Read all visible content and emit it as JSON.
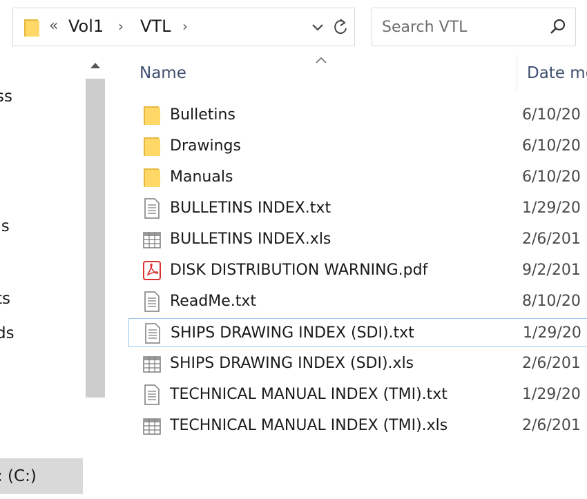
{
  "address_bar": {
    "overflow": "«",
    "breadcrumbs": [
      "Vol1",
      "VTL"
    ],
    "separator": "›",
    "dropdown_icon": "chevron-down-icon",
    "refresh_icon": "refresh-icon"
  },
  "search": {
    "placeholder": "Search VTL",
    "value": "",
    "icon": "search-icon"
  },
  "nav_pane": {
    "items": [
      {
        "label": "ss"
      },
      {
        "label": ":s"
      },
      {
        "label": "ts"
      },
      {
        "label": "ds"
      }
    ],
    "selected_item": {
      "label": ": (C:)"
    }
  },
  "file_list": {
    "columns": [
      {
        "label": "Name",
        "sorted": "ascending"
      },
      {
        "label": "Date mo"
      }
    ],
    "rows": [
      {
        "name": "Bulletins",
        "date": "6/10/20",
        "icon": "folder-icon"
      },
      {
        "name": "Drawings",
        "date": "6/10/20",
        "icon": "folder-icon"
      },
      {
        "name": "Manuals",
        "date": "6/10/20",
        "icon": "folder-icon"
      },
      {
        "name": "BULLETINS INDEX.txt",
        "date": "1/29/20",
        "icon": "text-file-icon"
      },
      {
        "name": "BULLETINS INDEX.xls",
        "date": "2/6/201",
        "icon": "spreadsheet-file-icon"
      },
      {
        "name": "DISK DISTRIBUTION WARNING.pdf",
        "date": "9/2/201",
        "icon": "pdf-file-icon"
      },
      {
        "name": "ReadMe.txt",
        "date": "8/10/20",
        "icon": "text-file-icon"
      },
      {
        "name": "SHIPS DRAWING INDEX (SDI).txt",
        "date": "1/29/20",
        "icon": "text-file-icon",
        "focused": true
      },
      {
        "name": "SHIPS DRAWING INDEX (SDI).xls",
        "date": "2/6/201",
        "icon": "spreadsheet-file-icon"
      },
      {
        "name": "TECHNICAL MANUAL INDEX (TMI).txt",
        "date": "1/29/20",
        "icon": "text-file-icon"
      },
      {
        "name": "TECHNICAL MANUAL INDEX (TMI).xls",
        "date": "2/6/201",
        "icon": "spreadsheet-file-icon"
      }
    ]
  },
  "colors": {
    "folder": "#ffd868",
    "folder_dark": "#e8b83e",
    "pdf_red": "#d9302e",
    "focus_border": "#99c7ee",
    "header_text": "#3e4f6e",
    "nav_selected_bg": "#d9d9d9"
  }
}
